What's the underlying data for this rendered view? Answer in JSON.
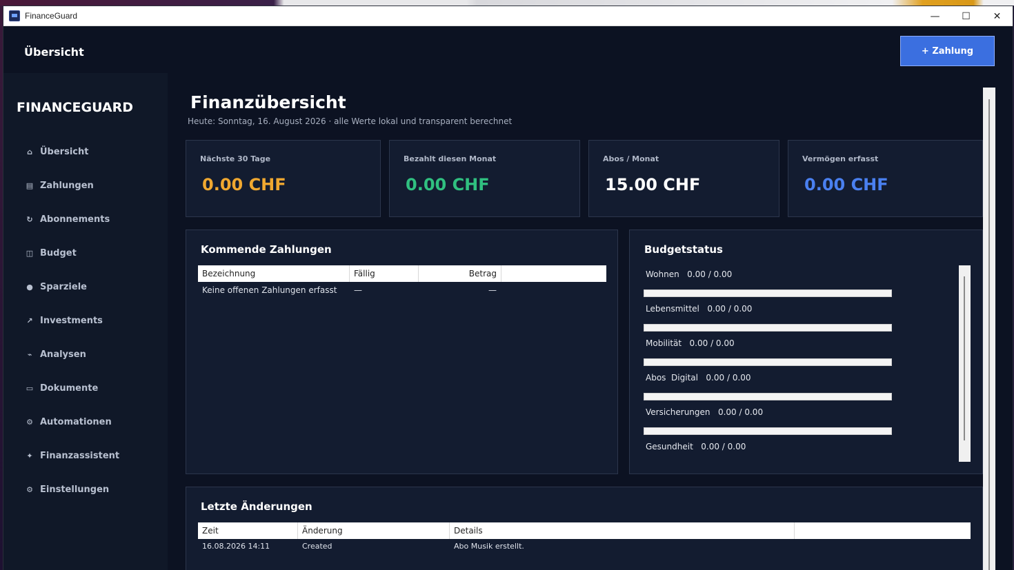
{
  "window": {
    "title": "FinanceGuard",
    "controls": {
      "minimize": "—",
      "maximize": "☐",
      "close": "✕"
    }
  },
  "header": {
    "title": "Übersicht",
    "add_button": "+ Zahlung"
  },
  "sidebar": {
    "brand": "FINANCEGUARD",
    "items": [
      {
        "icon": "⌂",
        "label": "Übersicht"
      },
      {
        "icon": "▤",
        "label": "Zahlungen"
      },
      {
        "icon": "↻",
        "label": "Abonnements"
      },
      {
        "icon": "◫",
        "label": "Budget"
      },
      {
        "icon": "●",
        "label": "Sparziele"
      },
      {
        "icon": "↗",
        "label": "Investments"
      },
      {
        "icon": "⌁",
        "label": "Analysen"
      },
      {
        "icon": "▭",
        "label": "Dokumente"
      },
      {
        "icon": "⚙",
        "label": "Automationen"
      },
      {
        "icon": "✦",
        "label": "Finanzassistent"
      },
      {
        "icon": "⚙",
        "label": "Einstellungen"
      }
    ]
  },
  "main": {
    "title": "Finanzübersicht",
    "subtitle": "Heute: Sonntag, 16. August 2026 · alle Werte lokal und transparent berechnet",
    "kpis": [
      {
        "label": "Nächste 30 Tage",
        "value": "0.00 CHF",
        "color": "#f0a830"
      },
      {
        "label": "Bezahlt diesen Monat",
        "value": "0.00 CHF",
        "color": "#30c080"
      },
      {
        "label": "Abos / Monat",
        "value": "15.00 CHF",
        "color": "#ffffff"
      },
      {
        "label": "Vermögen erfasst",
        "value": "0.00 CHF",
        "color": "#4a80f0"
      }
    ],
    "upcoming": {
      "title": "Kommende Zahlungen",
      "columns": [
        "Bezeichnung",
        "Fällig",
        "Betrag"
      ],
      "rows": [
        [
          "Keine offenen Zahlungen erfasst",
          "—",
          "—"
        ]
      ]
    },
    "budget": {
      "title": "Budgetstatus",
      "items": [
        {
          "name": "Wohnen",
          "value": "0.00 / 0.00",
          "progress": 0
        },
        {
          "name": "Lebensmittel",
          "value": "0.00 / 0.00",
          "progress": 0
        },
        {
          "name": "Mobilität",
          "value": "0.00 / 0.00",
          "progress": 0
        },
        {
          "name": "Abos  Digital",
          "value": "0.00 / 0.00",
          "progress": 0
        },
        {
          "name": "Versicherungen",
          "value": "0.00 / 0.00",
          "progress": 0
        },
        {
          "name": "Gesundheit",
          "value": "0.00 / 0.00",
          "progress": 0
        }
      ]
    },
    "changes": {
      "title": "Letzte Änderungen",
      "columns": [
        "Zeit",
        "Änderung",
        "Details"
      ],
      "rows": [
        [
          "16.08.2026 14:11",
          "Created",
          "Abo Musik erstellt."
        ]
      ]
    }
  }
}
